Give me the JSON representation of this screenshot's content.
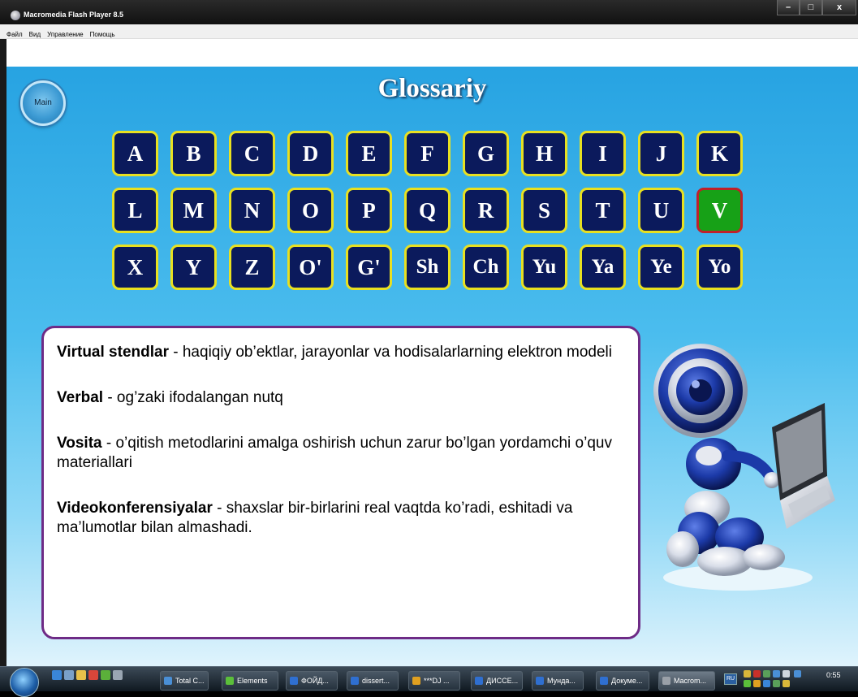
{
  "window": {
    "title": "Macromedia Flash Player 8.5",
    "controls": {
      "minimize": "–",
      "maximize": "□",
      "close": "x"
    }
  },
  "menu": [
    "Файл",
    "Вид",
    "Управление",
    "Помощь"
  ],
  "main_button": "Main",
  "page_title": "Glossariy",
  "alphabet": {
    "row1": [
      "A",
      "B",
      "C",
      "D",
      "E",
      "F",
      "G",
      "H",
      "I",
      "J",
      "K"
    ],
    "row2": [
      "L",
      "M",
      "N",
      "O",
      "P",
      "Q",
      "R",
      "S",
      "T",
      "U",
      "V"
    ],
    "row3": [
      "X",
      "Y",
      "Z",
      "O'",
      "G'",
      "Sh",
      "Ch",
      "Yu",
      "Ya",
      "Ye",
      "Yo"
    ],
    "active_letter": "V"
  },
  "entries": [
    {
      "term": "Virtual stendlar",
      "definition": " - haqiqiy ob’ektlar, jarayonlar va hodisalarlarning elektron modeli"
    },
    {
      "term": "Verbal",
      "definition": " - og’zaki ifodalangan nutq"
    },
    {
      "term": "Vosita",
      "definition": " - o’qitish metodlarini amalga oshirish uchun zarur bo’lgan yordamchi o’quv materiallari"
    },
    {
      "term": "Videokonferensiyalar",
      "definition": " - shaxslar bir-birlarini real vaqtda ko’radi, eshitadi va ma’lumotlar bilan almashadi."
    }
  ],
  "taskbar": {
    "tasks": [
      {
        "label": "Total C...",
        "icon": "total-commander-icon",
        "color": "#4a8fd6"
      },
      {
        "label": "Elements",
        "icon": "elements-icon",
        "color": "#5bbf3a"
      },
      {
        "label": "ФОЙД...",
        "icon": "word-icon",
        "color": "#2f6fd0"
      },
      {
        "label": "dissert...",
        "icon": "word-icon",
        "color": "#2f6fd0"
      },
      {
        "label": "***DJ ...",
        "icon": "winamp-icon",
        "color": "#e0a020"
      },
      {
        "label": "ДИССЕ...",
        "icon": "word-icon",
        "color": "#2f6fd0"
      },
      {
        "label": "Мунда...",
        "icon": "word-icon",
        "color": "#2f6fd0"
      },
      {
        "label": "Докуме...",
        "icon": "word-icon",
        "color": "#2f6fd0"
      },
      {
        "label": "Macrom...",
        "icon": "flash-player-icon",
        "color": "#9aa0a8"
      }
    ],
    "language": "RU",
    "clock": "0:55"
  }
}
